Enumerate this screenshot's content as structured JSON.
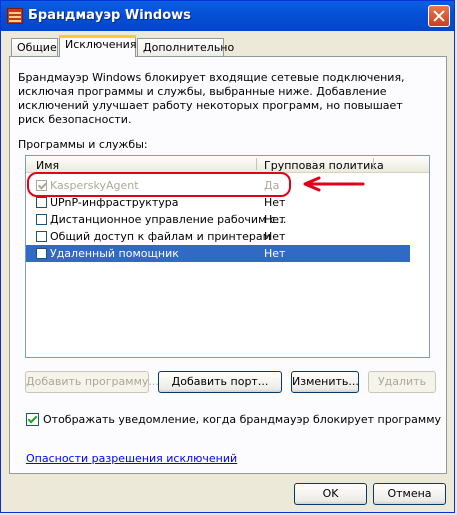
{
  "window": {
    "title": "Брандмауэр Windows"
  },
  "tabs": [
    {
      "label": "Общие"
    },
    {
      "label": "Исключения"
    },
    {
      "label": "Дополнительно"
    }
  ],
  "description": "Брандмауэр Windows блокирует входящие сетевые подключения, исключая программы и службы, выбранные ниже. Добавление исключений улучшает работу некоторых программ, но повышает риск безопасности.",
  "programs_label": "Программы и службы:",
  "list": {
    "columns": [
      "Имя",
      "Групповая политика"
    ],
    "rows": [
      {
        "name": "KasperskyAgent",
        "policy": "Да",
        "checked": true,
        "disabled": true
      },
      {
        "name": "UPnP-инфраструктура",
        "policy": "Нет",
        "checked": false
      },
      {
        "name": "Дистанционное управление рабочим с...",
        "policy": "Нет",
        "checked": false
      },
      {
        "name": "Общий доступ к файлам и принтерам",
        "policy": "Нет",
        "checked": false
      },
      {
        "name": "Удаленный помощник",
        "policy": "Нет",
        "checked": false,
        "selected": true
      }
    ]
  },
  "buttons": {
    "add_program": "Добавить программу...",
    "add_port": "Добавить порт...",
    "edit": "Изменить...",
    "delete": "Удалить",
    "ok": "OK",
    "cancel": "Отмена"
  },
  "notify_label": "Отображать уведомление, когда брандмауэр блокирует программу",
  "risks_link": "Опасности разрешения исключений",
  "colors": {
    "title_bar": "#0551d6",
    "selection": "#316ac5",
    "annotation": "#e0001b"
  },
  "icons": [
    "firewall-icon",
    "close-icon",
    "checkbox-icon",
    "arrow-annotation-icon"
  ]
}
